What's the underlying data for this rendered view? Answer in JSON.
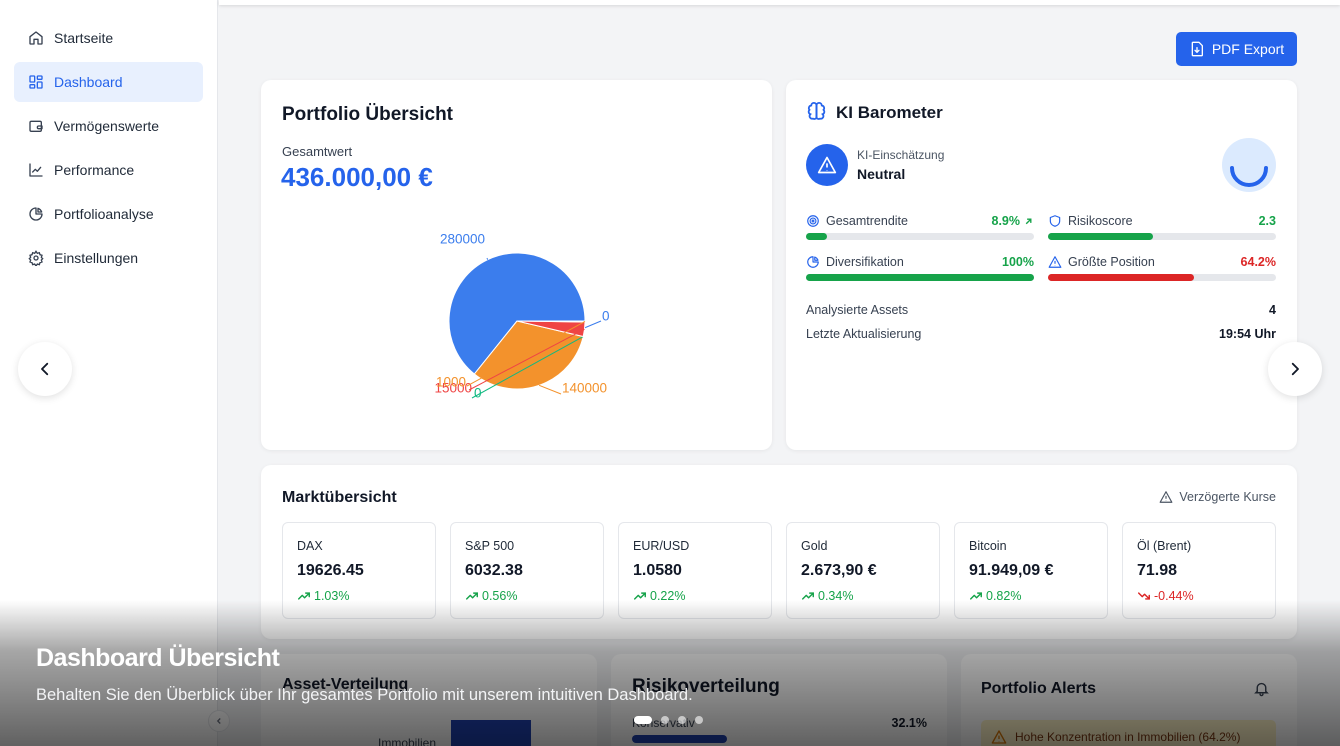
{
  "sidebar": {
    "items": [
      {
        "label": "Startseite",
        "icon": "home-icon"
      },
      {
        "label": "Dashboard",
        "icon": "grid-icon",
        "active": true
      },
      {
        "label": "Vermögenswerte",
        "icon": "wallet-icon"
      },
      {
        "label": "Performance",
        "icon": "line-chart-icon"
      },
      {
        "label": "Portfolioanalyse",
        "icon": "pie-chart-icon"
      },
      {
        "label": "Einstellungen",
        "icon": "gear-icon"
      }
    ]
  },
  "toolbar": {
    "pdf_export_label": "PDF Export"
  },
  "portfolio": {
    "title": "Portfolio Übersicht",
    "total_label": "Gesamtwert",
    "total_value": "436.000,00 €"
  },
  "chart_data": {
    "type": "pie",
    "slices": [
      {
        "label": "280000",
        "value": 280000,
        "color": "#3b7ded"
      },
      {
        "label": "0",
        "value": 0,
        "color": "#3b7ded"
      },
      {
        "label": "140000",
        "value": 140000,
        "color": "#f3922c"
      },
      {
        "label": "0",
        "value": 0,
        "color": "#10b981"
      },
      {
        "label": "15000",
        "value": 15000,
        "color": "#ef4444"
      },
      {
        "label": "1000",
        "value": 1000,
        "color": "#f3922c"
      }
    ]
  },
  "ki": {
    "title": "KI Barometer",
    "assessment_label": "KI-Einschätzung",
    "assessment_value": "Neutral",
    "metrics": [
      {
        "label": "Gesamtrendite",
        "value": "8.9%",
        "fill": 0.09,
        "color": "#16a34a",
        "icon": "target-icon",
        "trend": "up"
      },
      {
        "label": "Risikoscore",
        "value": "2.3",
        "fill": 0.46,
        "color": "#16a34a",
        "icon": "shield-icon"
      },
      {
        "label": "Diversifikation",
        "value": "100%",
        "fill": 1.0,
        "color": "#16a34a",
        "icon": "pie-chart-icon"
      },
      {
        "label": "Größte Position",
        "value": "64.2%",
        "fill": 0.642,
        "color": "#dc2626",
        "icon": "warning-icon"
      }
    ],
    "info": [
      {
        "label": "Analysierte Assets",
        "value": "4"
      },
      {
        "label": "Letzte Aktualisierung",
        "value": "19:54 Uhr"
      }
    ]
  },
  "market": {
    "title": "Marktübersicht",
    "notice": "Verzögerte Kurse",
    "tiles": [
      {
        "name": "DAX",
        "value": "19626.45",
        "change": "1.03%",
        "dir": "up"
      },
      {
        "name": "S&P 500",
        "value": "6032.38",
        "change": "0.56%",
        "dir": "up"
      },
      {
        "name": "EUR/USD",
        "value": "1.0580",
        "change": "0.22%",
        "dir": "up"
      },
      {
        "name": "Gold",
        "value": "2.673,90 €",
        "change": "0.34%",
        "dir": "up"
      },
      {
        "name": "Bitcoin",
        "value": "91.949,09 €",
        "change": "0.82%",
        "dir": "up"
      },
      {
        "name": "Öl (Brent)",
        "value": "71.98",
        "change": "-0.44%",
        "dir": "down"
      }
    ]
  },
  "bottom": {
    "asset_title": "Asset-Verteilung",
    "asset_label": "Immobilien",
    "risk_title": "Risikoverteilung",
    "risk_label": "Konservativ",
    "risk_value": "32.1%",
    "alerts_title": "Portfolio Alerts",
    "alert_text": "Hohe Konzentration in Immobilien (64.2%)"
  },
  "overlay": {
    "title": "Dashboard Übersicht",
    "subtitle": "Behalten Sie den Überblick über Ihr gesamtes Portfolio mit unserem intuitiven Dashboard."
  },
  "carousel": {
    "slide_count": 4,
    "active": 0
  },
  "colors": {
    "accent": "#2563eb",
    "positive": "#16a34a",
    "negative": "#dc2626"
  }
}
